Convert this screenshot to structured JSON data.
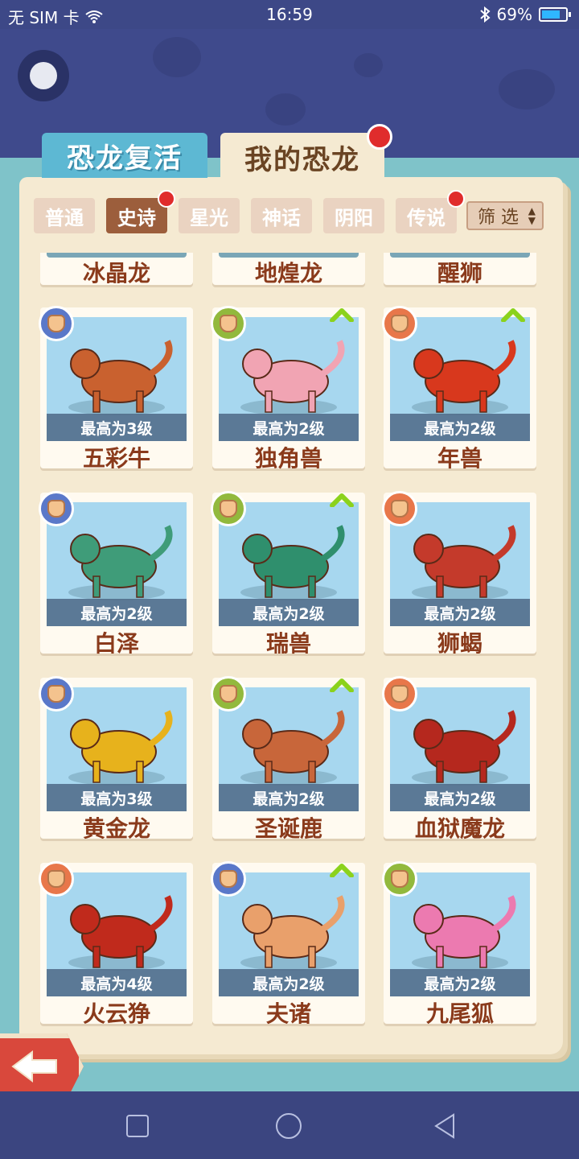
{
  "status_bar": {
    "carrier": "无 SIM 卡",
    "time": "16:59",
    "battery": "69%"
  },
  "main_tabs": [
    {
      "label": "恐龙复活",
      "active": false
    },
    {
      "label": "我的恐龙",
      "active": true,
      "dot": true
    }
  ],
  "filter_tabs": [
    {
      "label": "普通",
      "active": false,
      "dot": false
    },
    {
      "label": "史诗",
      "active": true,
      "dot": true
    },
    {
      "label": "星光",
      "active": false,
      "dot": false
    },
    {
      "label": "神话",
      "active": false,
      "dot": false
    },
    {
      "label": "阴阳",
      "active": false,
      "dot": false
    },
    {
      "label": "传说",
      "active": false,
      "dot": true
    }
  ],
  "filter_button": {
    "label": "筛 选"
  },
  "partial_row": [
    "冰晶龙",
    "地煌龙",
    "醒狮"
  ],
  "cards": [
    {
      "name": "五彩牛",
      "level": "最高为3级",
      "badge": "blue",
      "upgrade": false,
      "color": "#c9612f"
    },
    {
      "name": "独角兽",
      "level": "最高为2级",
      "badge": "green",
      "upgrade": true,
      "color": "#f1a4b3"
    },
    {
      "name": "年兽",
      "level": "最高为2级",
      "badge": "orange",
      "upgrade": true,
      "color": "#d8381d"
    },
    {
      "name": "白泽",
      "level": "最高为2级",
      "badge": "blue",
      "upgrade": false,
      "color": "#3f9c79"
    },
    {
      "name": "瑞兽",
      "level": "最高为2级",
      "badge": "green",
      "upgrade": true,
      "color": "#2f8f6d"
    },
    {
      "name": "狮蝎",
      "level": "最高为2级",
      "badge": "orange",
      "upgrade": false,
      "color": "#c43a2b"
    },
    {
      "name": "黄金龙",
      "level": "最高为3级",
      "badge": "blue",
      "upgrade": false,
      "color": "#e7b21c"
    },
    {
      "name": "圣诞鹿",
      "level": "最高为2级",
      "badge": "green",
      "upgrade": true,
      "color": "#c8663a"
    },
    {
      "name": "血狱魔龙",
      "level": "最高为2级",
      "badge": "orange",
      "upgrade": false,
      "color": "#b5281e"
    },
    {
      "name": "火云狰",
      "level": "最高为4级",
      "badge": "orange",
      "upgrade": false,
      "color": "#c02a1c"
    },
    {
      "name": "夫诸",
      "level": "最高为2级",
      "badge": "blue",
      "upgrade": true,
      "color": "#e9a06b"
    },
    {
      "name": "九尾狐",
      "level": "最高为2级",
      "badge": "green",
      "upgrade": false,
      "color": "#ec7ab0"
    }
  ],
  "nav": {
    "back": "back",
    "home": "home",
    "recent": "recent"
  }
}
